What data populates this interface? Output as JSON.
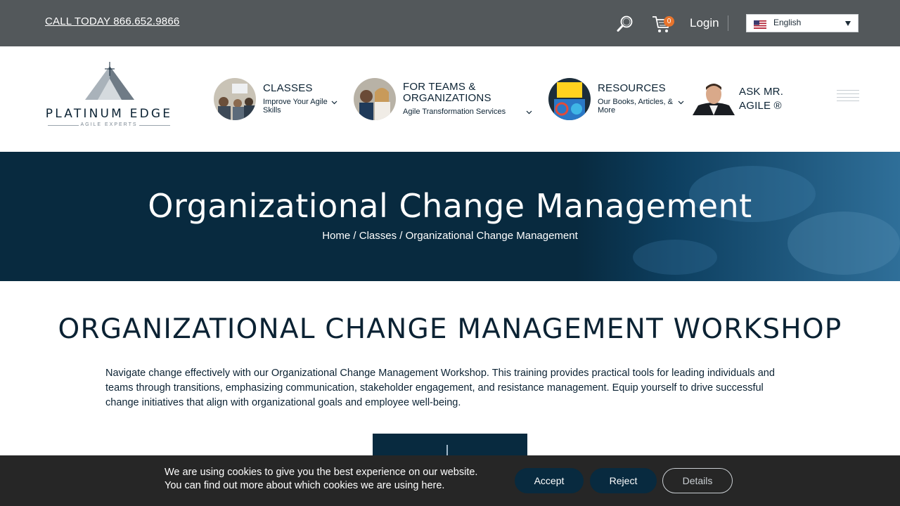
{
  "topbar": {
    "call_text": "CALL TODAY 866.652.9866",
    "cart_count": "0",
    "login_label": "Login",
    "language": "English",
    "search_icon": "search-icon",
    "cart_icon": "shopping-cart-icon"
  },
  "logo": {
    "name": "PLATINUM EDGE",
    "tagline": "AGILE EXPERTS"
  },
  "nav": {
    "items": [
      {
        "title": "CLASSES",
        "subtitle": "Improve Your Agile Skills"
      },
      {
        "title": "FOR TEAMS & ORGANIZATIONS",
        "subtitle": "Agile Transformation Services"
      },
      {
        "title": "RESOURCES",
        "subtitle": "Our Books, Articles, & More"
      },
      {
        "title": "ASK MR. AGILE ®",
        "subtitle": ""
      }
    ]
  },
  "hero": {
    "title": "Organizational Change Management",
    "breadcrumb": [
      "Home",
      "Classes",
      "Organizational Change Management"
    ],
    "separator": " / "
  },
  "main": {
    "heading": "ORGANIZATIONAL CHANGE MANAGEMENT WORKSHOP",
    "intro": "Navigate change effectively with our Organizational Change Management Workshop. This training provides practical tools for leading individuals and teams through transitions, emphasizing communication, stakeholder engagement, and resistance management. Equip yourself to drive successful change initiatives that align with organizational goals and employee well-being."
  },
  "cookie": {
    "line1": "We are using cookies to give you the best experience on our website.",
    "line2": "You can find out more about which cookies we are using here.",
    "accept_label": "Accept",
    "reject_label": "Reject",
    "details_label": "Details"
  },
  "colors": {
    "topbar_bg": "#53585b",
    "navy": "#082a3f",
    "badge": "#e8742c",
    "cookie_bg": "#262626"
  }
}
